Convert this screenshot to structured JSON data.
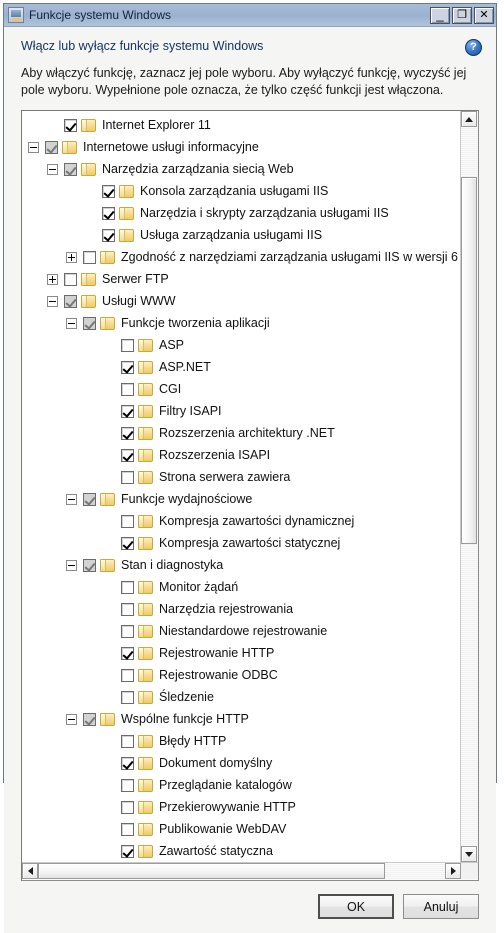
{
  "window": {
    "title": "Funkcje systemu Windows",
    "app_icon": "windows-features-icon",
    "minimize_label": "_",
    "maximize_label": "❐",
    "close_label": "✕"
  },
  "content": {
    "heading": "Włącz lub wyłącz funkcje systemu Windows",
    "help_label": "?",
    "description": "Aby włączyć funkcję, zaznacz jej pole wyboru. Aby wyłączyć funkcję, wyczyść jej pole wyboru. Wypełnione pole oznacza, że tylko część funkcji jest włączona."
  },
  "tree": {
    "rows": [
      {
        "label": "Internet Explorer 11",
        "indent": 1,
        "expander": "none",
        "check": "checked"
      },
      {
        "label": "Internetowe usługi informacyjne",
        "indent": 0,
        "expander": "minus",
        "check": "partial"
      },
      {
        "label": "Narzędzia zarządzania siecią Web",
        "indent": 1,
        "expander": "minus",
        "check": "partial"
      },
      {
        "label": "Konsola zarządzania usługami IIS",
        "indent": 3,
        "expander": "none",
        "check": "checked"
      },
      {
        "label": "Narzędzia i skrypty zarządzania usługami IIS",
        "indent": 3,
        "expander": "none",
        "check": "checked"
      },
      {
        "label": "Usługa zarządzania usługami IIS",
        "indent": 3,
        "expander": "none",
        "check": "checked"
      },
      {
        "label": "Zgodność z narzędziami zarządzania usługami IIS w wersji 6",
        "indent": 2,
        "expander": "plus",
        "check": "unchecked"
      },
      {
        "label": "Serwer FTP",
        "indent": 1,
        "expander": "plus",
        "check": "unchecked"
      },
      {
        "label": "Usługi WWW",
        "indent": 1,
        "expander": "minus",
        "check": "partial"
      },
      {
        "label": "Funkcje tworzenia aplikacji",
        "indent": 2,
        "expander": "minus",
        "check": "partial"
      },
      {
        "label": "ASP",
        "indent": 4,
        "expander": "none",
        "check": "unchecked"
      },
      {
        "label": "ASP.NET",
        "indent": 4,
        "expander": "none",
        "check": "checked"
      },
      {
        "label": "CGI",
        "indent": 4,
        "expander": "none",
        "check": "unchecked"
      },
      {
        "label": "Filtry ISAPI",
        "indent": 4,
        "expander": "none",
        "check": "checked"
      },
      {
        "label": "Rozszerzenia architektury .NET",
        "indent": 4,
        "expander": "none",
        "check": "checked"
      },
      {
        "label": "Rozszerzenia ISAPI",
        "indent": 4,
        "expander": "none",
        "check": "checked"
      },
      {
        "label": "Strona serwera zawiera",
        "indent": 4,
        "expander": "none",
        "check": "unchecked"
      },
      {
        "label": "Funkcje wydajnościowe",
        "indent": 2,
        "expander": "minus",
        "check": "partial"
      },
      {
        "label": "Kompresja zawartości dynamicznej",
        "indent": 4,
        "expander": "none",
        "check": "unchecked"
      },
      {
        "label": "Kompresja zawartości statycznej",
        "indent": 4,
        "expander": "none",
        "check": "checked"
      },
      {
        "label": "Stan i diagnostyka",
        "indent": 2,
        "expander": "minus",
        "check": "partial"
      },
      {
        "label": "Monitor żądań",
        "indent": 4,
        "expander": "none",
        "check": "unchecked"
      },
      {
        "label": "Narzędzia rejestrowania",
        "indent": 4,
        "expander": "none",
        "check": "unchecked"
      },
      {
        "label": "Niestandardowe rejestrowanie",
        "indent": 4,
        "expander": "none",
        "check": "unchecked"
      },
      {
        "label": "Rejestrowanie HTTP",
        "indent": 4,
        "expander": "none",
        "check": "checked"
      },
      {
        "label": "Rejestrowanie ODBC",
        "indent": 4,
        "expander": "none",
        "check": "unchecked"
      },
      {
        "label": "Śledzenie",
        "indent": 4,
        "expander": "none",
        "check": "unchecked"
      },
      {
        "label": "Wspólne funkcje HTTP",
        "indent": 2,
        "expander": "minus",
        "check": "partial"
      },
      {
        "label": "Błędy HTTP",
        "indent": 4,
        "expander": "none",
        "check": "unchecked"
      },
      {
        "label": "Dokument domyślny",
        "indent": 4,
        "expander": "none",
        "check": "checked"
      },
      {
        "label": "Przeglądanie katalogów",
        "indent": 4,
        "expander": "none",
        "check": "unchecked"
      },
      {
        "label": "Przekierowywanie HTTP",
        "indent": 4,
        "expander": "none",
        "check": "unchecked"
      },
      {
        "label": "Publikowanie WebDAV",
        "indent": 4,
        "expander": "none",
        "check": "unchecked"
      },
      {
        "label": "Zawartość statyczna",
        "indent": 4,
        "expander": "none",
        "check": "checked"
      }
    ]
  },
  "scrollbars": {
    "vertical": {
      "thumb_top_pct": 7,
      "thumb_height_pct": 51
    },
    "horizontal": {
      "thumb_left_pct": 0,
      "thumb_width_pct": 82
    }
  },
  "buttons": {
    "ok": "OK",
    "cancel": "Anuluj"
  }
}
